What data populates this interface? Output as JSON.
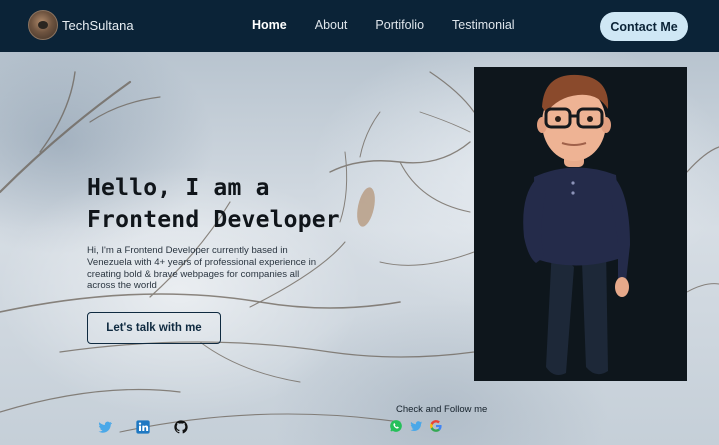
{
  "brand": {
    "name": "TechSultana"
  },
  "nav": {
    "links": [
      {
        "label": "Home"
      },
      {
        "label": "About"
      },
      {
        "label": "Portifolio"
      },
      {
        "label": "Testimonial"
      }
    ],
    "contact_label": "Contact Me"
  },
  "hero": {
    "title_line1": "Hello, I am a",
    "title_line2": "Frontend Developer",
    "description": "Hi, I'm a Frontend Developer currently based in Venezuela with 4+ years of professional experience in creating bold & brave webpages for companies all across the world",
    "cta_label": "Let's talk with me"
  },
  "social": {
    "left_icons": [
      "twitter-icon",
      "linkedin-icon",
      "github-icon"
    ],
    "follow_label": "Check and Follow me",
    "follow_icons": [
      "whatsapp-icon",
      "twitter-icon",
      "google-icon"
    ]
  },
  "colors": {
    "navbar": "#0b2337",
    "contact_button": "#cfe7f5",
    "profile_card": "#0e161c"
  }
}
